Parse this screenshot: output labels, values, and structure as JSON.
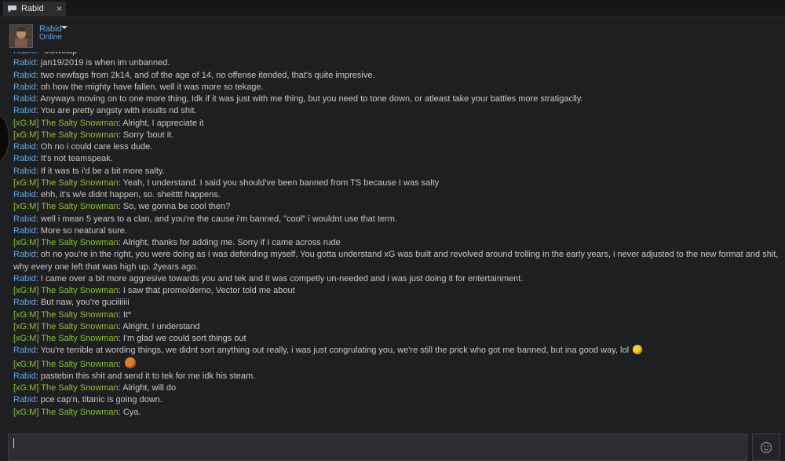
{
  "tab": {
    "title": "Rabid",
    "close_glyph": "×",
    "icon": "chat-bubble-icon"
  },
  "header": {
    "name": "Rabid",
    "status": "Online",
    "menu_icon": "chevron-down-icon"
  },
  "colors": {
    "rabid": "#62a7e3",
    "salty": "#8fbf33",
    "text": "#c8c8c8",
    "background": "#1e1f20"
  },
  "messages": [
    {
      "sender": "Rabid",
      "kind": "rabid",
      "text": "*slowclap*"
    },
    {
      "sender": "Rabid",
      "kind": "rabid",
      "text": "jan19/2019 is when im unbanned."
    },
    {
      "sender": "Rabid",
      "kind": "rabid",
      "text": "two newfags from 2k14, and of the age of 14, no offense itended, that's quite impresive."
    },
    {
      "sender": "Rabid",
      "kind": "rabid",
      "text": "oh how the mighty have fallen. well it was more so tekage."
    },
    {
      "sender": "Rabid",
      "kind": "rabid",
      "text": "Anyways moving on to one more thing, Idk if it was just with me thing, but you need to tone down, or atleast take your battles more stratigaclly."
    },
    {
      "sender": "Rabid",
      "kind": "rabid",
      "text": "You are pretty angsty with insults nd shit."
    },
    {
      "sender": "[xG:M] The Salty Snowman",
      "kind": "salty",
      "text": "Alright, I appreciate it"
    },
    {
      "sender": "[xG:M] The Salty Snowman",
      "kind": "salty",
      "text": "Sorry 'bout it."
    },
    {
      "sender": "Rabid",
      "kind": "rabid",
      "text": "Oh no i could care less dude."
    },
    {
      "sender": "Rabid",
      "kind": "rabid",
      "text": "It's not teamspeak."
    },
    {
      "sender": "Rabid",
      "kind": "rabid",
      "text": "If it was ts i'd be a bit more salty."
    },
    {
      "sender": "[xG:M] The Salty Snowman",
      "kind": "salty",
      "text": "Yeah, I understand. I said you should've been banned from TS because I was salty"
    },
    {
      "sender": "Rabid",
      "kind": "rabid",
      "text": "ehh, it's w/e didnt happen, so. sheitttt happens."
    },
    {
      "sender": "[xG:M] The Salty Snowman",
      "kind": "salty",
      "text": "So, we gonna be cool then?"
    },
    {
      "sender": "Rabid",
      "kind": "rabid",
      "text": "well i mean 5 years to a clan, and you're the cause i'm banned, \"cool\" i wouldnt use that term."
    },
    {
      "sender": "Rabid",
      "kind": "rabid",
      "text": "More so neatural sure."
    },
    {
      "sender": "[xG:M] The Salty Snowman",
      "kind": "salty",
      "text": "Alright, thanks for adding me. Sorry if I came across rude"
    },
    {
      "sender": "Rabid",
      "kind": "rabid",
      "text": "oh no you're in the right, you were doing as i was defending myself, You gotta understand xG was built and revolved around trolling in the early years, i never adjusted to the new format and shit, why every one left that was high up. 2years ago."
    },
    {
      "sender": "Rabid",
      "kind": "rabid",
      "text": "I came over a bit more aggresive towards you and tek and it was competly un-needed and i was just doing it for entertainment."
    },
    {
      "sender": "[xG:M] The Salty Snowman",
      "kind": "salty",
      "text": "I saw that promo/demo, Vector told me about"
    },
    {
      "sender": "Rabid",
      "kind": "rabid",
      "text": "But naw, you're guciiiiiii"
    },
    {
      "sender": "[xG:M] The Salty Snowman",
      "kind": "salty",
      "text": "It*"
    },
    {
      "sender": "[xG:M] The Salty Snowman",
      "kind": "salty",
      "text": "Alright, I understand"
    },
    {
      "sender": "[xG:M] The Salty Snowman",
      "kind": "salty",
      "text": "I'm glad we could sort things out"
    },
    {
      "sender": "Rabid",
      "kind": "rabid",
      "text": "You're terrible at wording things, we didnt sort anything out really, i was just congrulating you, we're still the prick who got me banned, but ina  good way, lol",
      "emoji": "yellow-smiley-emoticon-icon"
    },
    {
      "sender": "[xG:M] The Salty Snowman",
      "kind": "salty",
      "text": "",
      "emoji": "orange-face-emoticon-icon"
    },
    {
      "sender": "Rabid",
      "kind": "rabid",
      "text": "pastebin this shit and send it to tek for me idk his steam."
    },
    {
      "sender": "[xG:M] The Salty Snowman",
      "kind": "salty",
      "text": "Alright, will do"
    },
    {
      "sender": "Rabid",
      "kind": "rabid",
      "text": "pce cap'n, titanic is going down."
    },
    {
      "sender": "[xG:M] The Salty Snowman",
      "kind": "salty",
      "text": "Cya."
    }
  ],
  "input": {
    "value": ""
  },
  "emoticon_button": {
    "icon": "smiley-face-icon"
  }
}
